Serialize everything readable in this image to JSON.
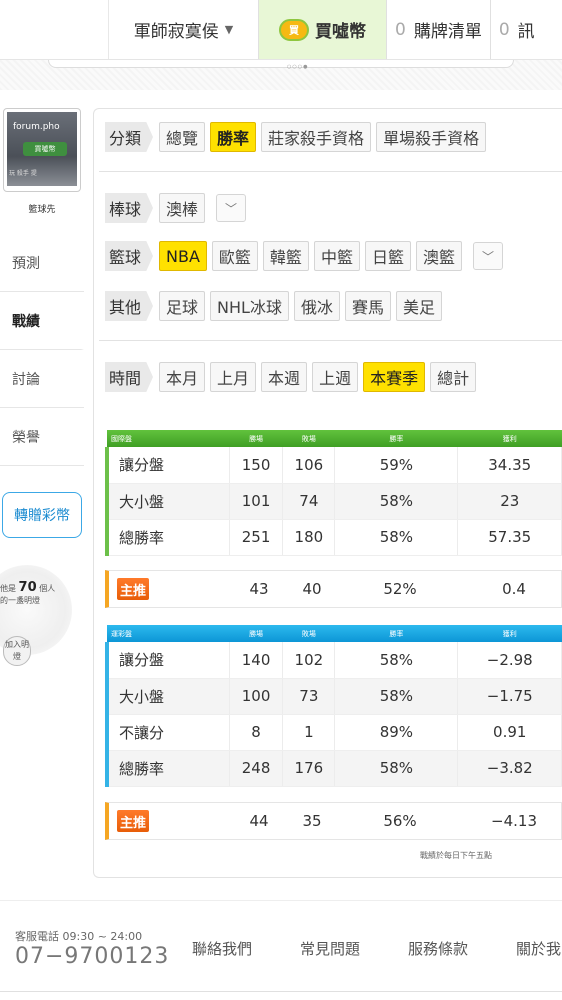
{
  "topbar": {
    "user": "軍師寂寞侯",
    "coin_icon": "coin-icon",
    "coin_text": "買",
    "buy": "買噓幣",
    "cart_count": "0",
    "cart_label": "購牌清單",
    "msg_count": "0",
    "msg_label": "訊"
  },
  "sidebar": {
    "avatar_text1": "forum.pho",
    "avatar_text2": "買噓幣",
    "avatar_text3": "玩 殺手 提",
    "name": "籃球先",
    "items": [
      "預測",
      "戰績",
      "討論",
      "榮譽"
    ],
    "active": "戰績",
    "gift": "轉贈彩幣",
    "bulb_prefix": "他是",
    "bulb_count": "70",
    "bulb_unit": "個人",
    "bulb_line2": "的一盞明燈",
    "join": "加入明燈"
  },
  "filters": {
    "category": {
      "label": "分類",
      "tags": [
        "總覽",
        "勝率",
        "莊家殺手資格",
        "單場殺手資格"
      ],
      "selected": "勝率"
    },
    "baseball": {
      "label": "棒球",
      "tags": [
        "澳棒"
      ]
    },
    "basketball": {
      "label": "籃球",
      "tags": [
        "NBA",
        "歐籃",
        "韓籃",
        "中籃",
        "日籃",
        "澳籃"
      ],
      "selected": "NBA"
    },
    "other": {
      "label": "其他",
      "tags": [
        "足球",
        "NHL冰球",
        "俄冰",
        "賽馬",
        "美足"
      ]
    },
    "time": {
      "label": "時間",
      "tags": [
        "本月",
        "上月",
        "本週",
        "上週",
        "本賽季",
        "總計"
      ],
      "selected": "本賽季"
    }
  },
  "table_intl": {
    "headers": [
      "國際盤",
      "勝場",
      "敗場",
      "勝率",
      "獲利"
    ],
    "rows": [
      [
        "讓分盤",
        "150",
        "106",
        "59%",
        "34.35"
      ],
      [
        "大小盤",
        "101",
        "74",
        "58%",
        "23"
      ],
      [
        "總勝率",
        "251",
        "180",
        "58%",
        "57.35"
      ]
    ],
    "main": {
      "badge": "主推",
      "win": "43",
      "loss": "40",
      "rate": "52%",
      "profit": "0.4"
    }
  },
  "table_lottery": {
    "headers": [
      "運彩盤",
      "勝場",
      "敗場",
      "勝率",
      "獲利"
    ],
    "rows": [
      [
        "讓分盤",
        "140",
        "102",
        "58%",
        "−2.98"
      ],
      [
        "大小盤",
        "100",
        "73",
        "58%",
        "−1.75"
      ],
      [
        "不讓分",
        "8",
        "1",
        "89%",
        "0.91"
      ],
      [
        "總勝率",
        "248",
        "176",
        "58%",
        "−3.82"
      ]
    ],
    "main": {
      "badge": "主推",
      "win": "44",
      "loss": "35",
      "rate": "56%",
      "profit": "−4.13"
    }
  },
  "note": "戰績於每日下午五點",
  "footer": {
    "service": "客服電話 09:30 ~ 24:00",
    "phone": "07−9700123",
    "links": [
      "聯絡我們",
      "常見問題",
      "服務條款",
      "關於我"
    ]
  }
}
